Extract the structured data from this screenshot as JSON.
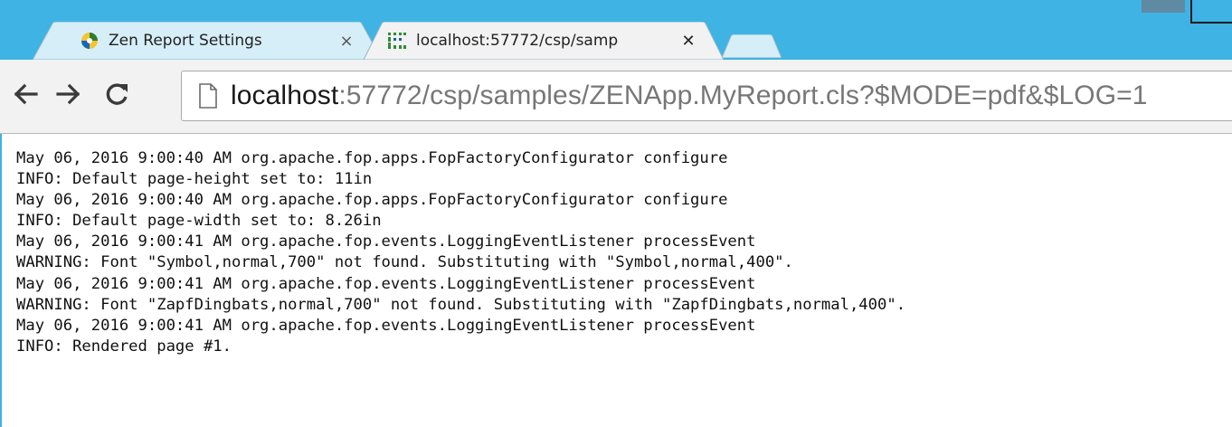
{
  "tabs": [
    {
      "title": "Zen Report Settings",
      "close": "×",
      "active": false,
      "icon": "puzzle-icon"
    },
    {
      "title": "localhost:57772/csp/samp",
      "close": "✕",
      "active": true,
      "icon": "zen-grid-icon"
    }
  ],
  "toolbar": {
    "back": "back-arrow-icon",
    "forward": "forward-arrow-icon",
    "reload": "reload-icon"
  },
  "address": {
    "host": "localhost",
    "rest": ":57772/csp/samples/ZENApp.MyReport.cls?$MODE=pdf&$LOG=1"
  },
  "log": [
    "May 06, 2016 9:00:40 AM org.apache.fop.apps.FopFactoryConfigurator configure",
    "INFO: Default page-height set to: 11in",
    "May 06, 2016 9:00:40 AM org.apache.fop.apps.FopFactoryConfigurator configure",
    "INFO: Default page-width set to: 8.26in",
    "May 06, 2016 9:00:41 AM org.apache.fop.events.LoggingEventListener processEvent",
    "WARNING: Font \"Symbol,normal,700\" not found. Substituting with \"Symbol,normal,400\".",
    "May 06, 2016 9:00:41 AM org.apache.fop.events.LoggingEventListener processEvent",
    "WARNING: Font \"ZapfDingbats,normal,700\" not found. Substituting with \"ZapfDingbats,normal,400\".",
    "May 06, 2016 9:00:41 AM org.apache.fop.events.LoggingEventListener processEvent",
    "INFO: Rendered page #1."
  ],
  "colors": {
    "frame": "#3eb3e4",
    "active_tab": "#f2f2f2",
    "inactive_tab": "#c9e8f5"
  }
}
